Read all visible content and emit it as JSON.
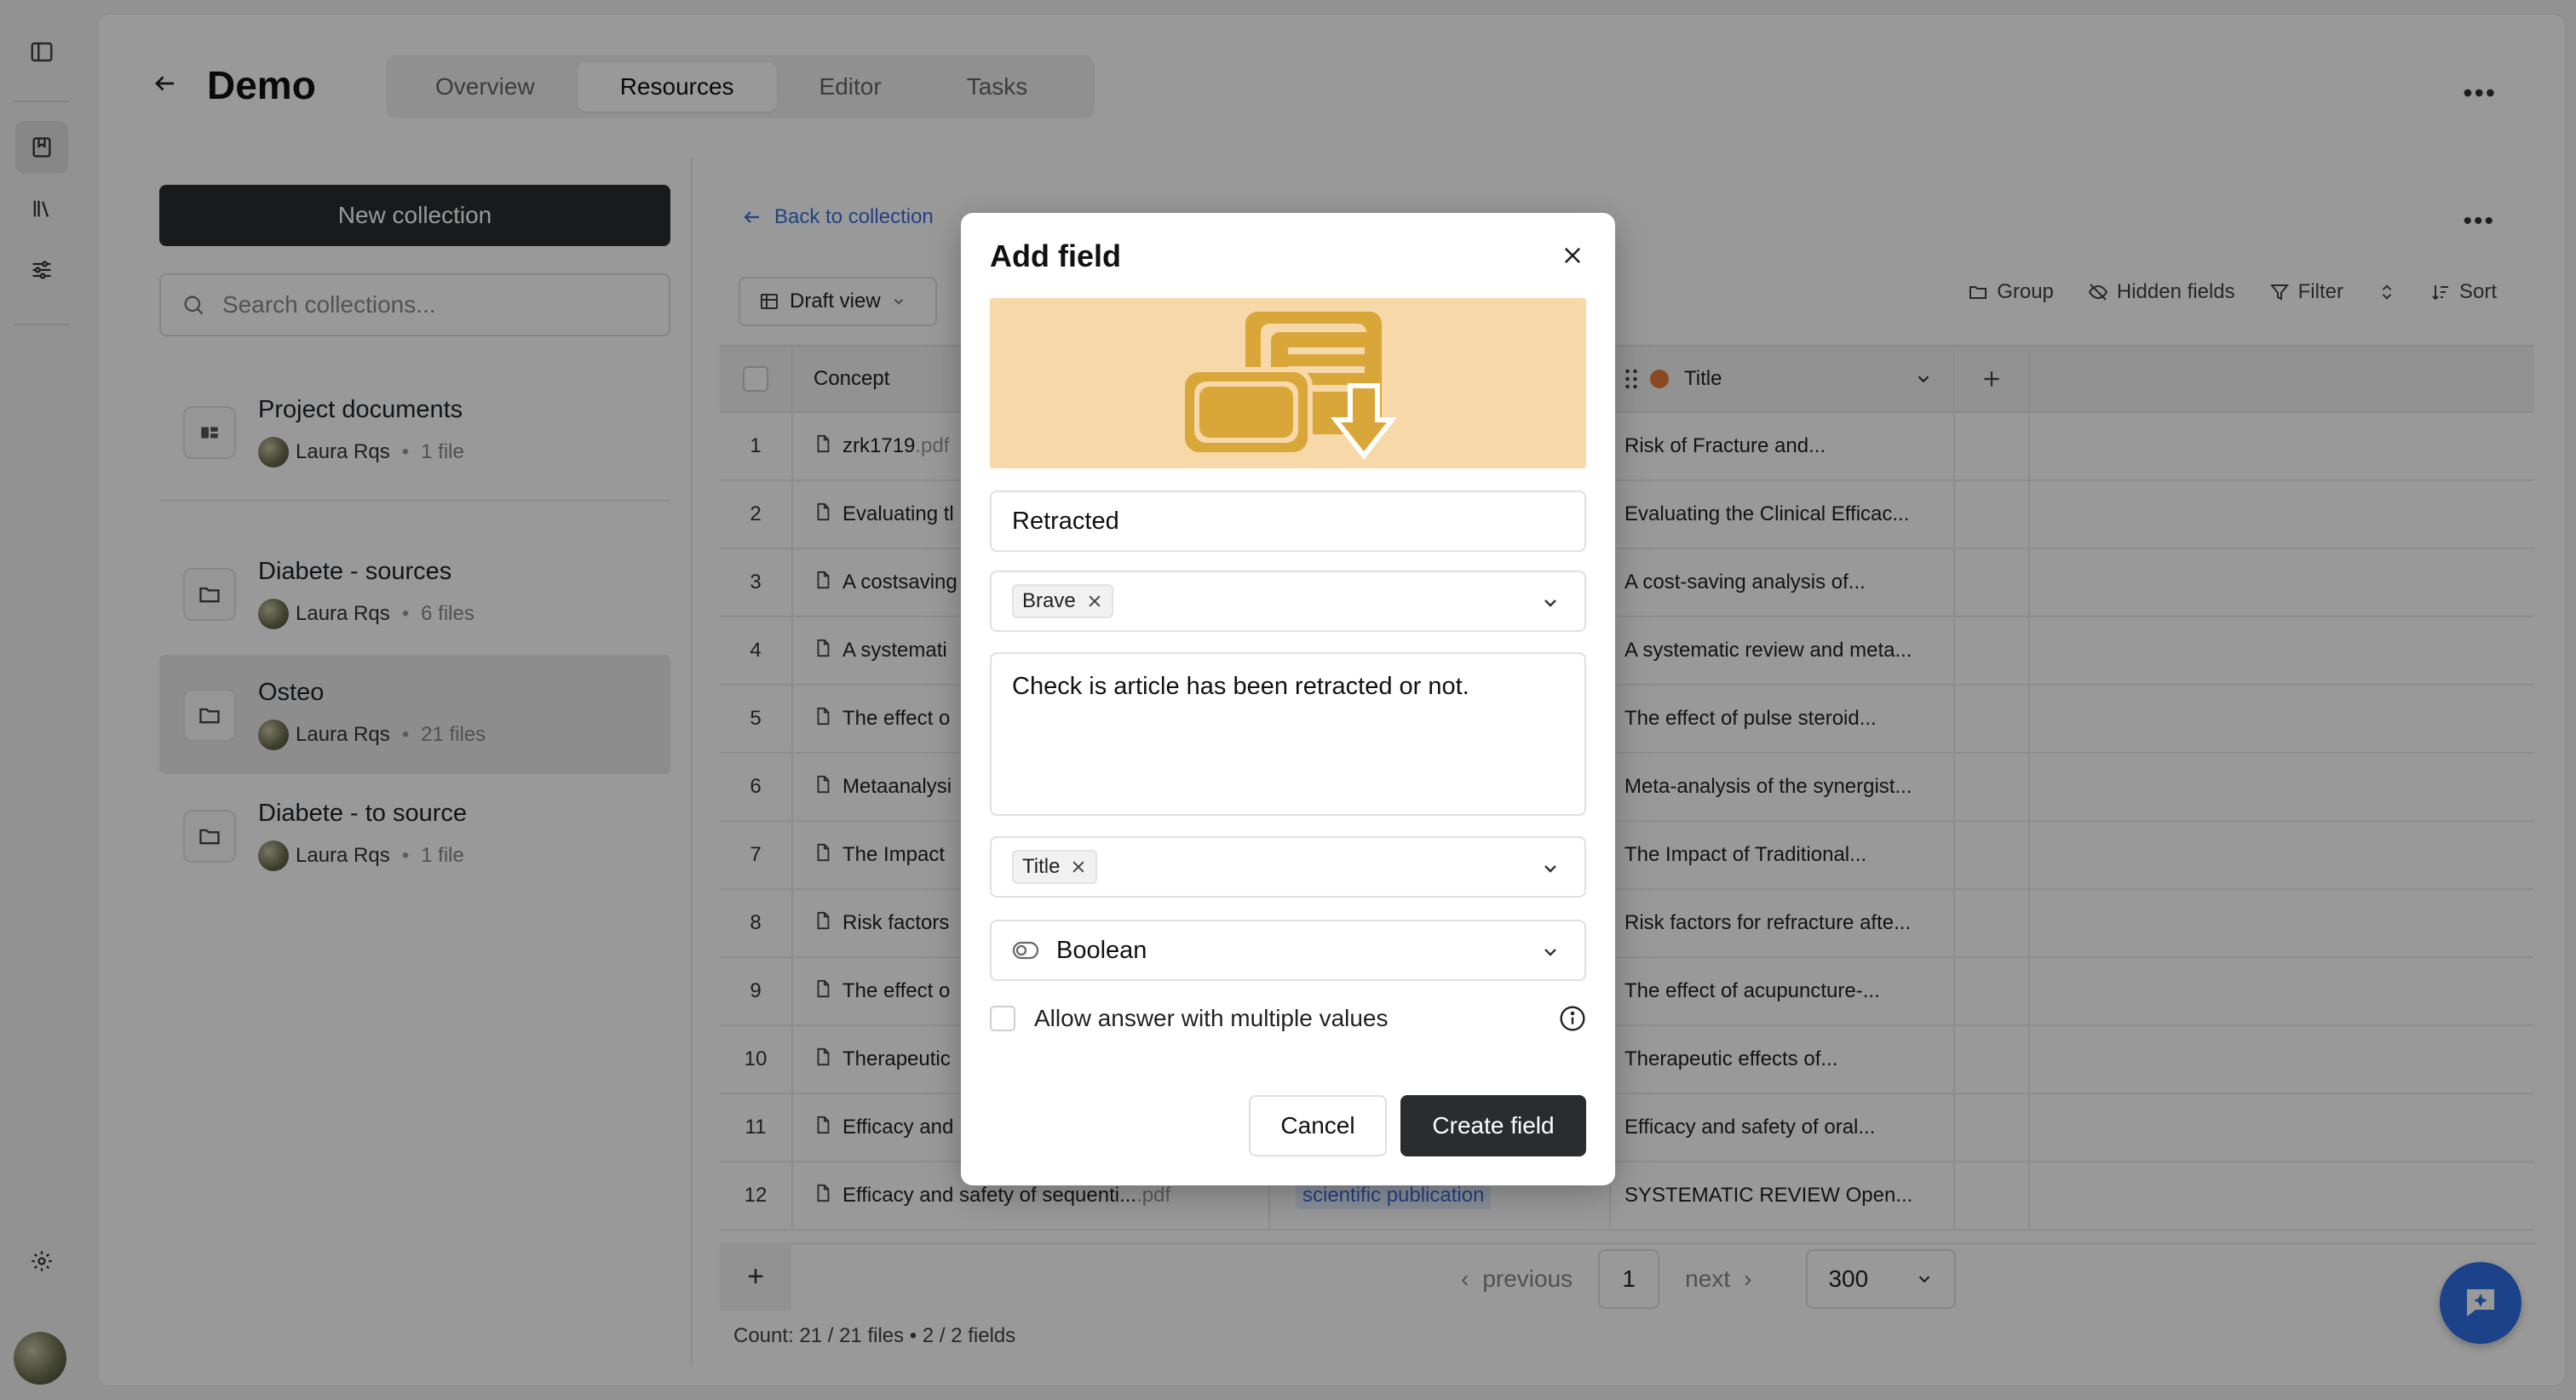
{
  "header": {
    "title": "Demo",
    "tabs": [
      {
        "label": "Overview"
      },
      {
        "label": "Resources"
      },
      {
        "label": "Editor"
      },
      {
        "label": "Tasks"
      }
    ],
    "active_tab": "Resources"
  },
  "collections": {
    "new_button": "New collection",
    "search_placeholder": "Search collections...",
    "items": [
      {
        "name": "Project documents",
        "owner": "Laura Rqs",
        "count": "1 file"
      },
      {
        "name": "Diabete - sources",
        "owner": "Laura Rqs",
        "count": "6 files"
      },
      {
        "name": "Osteo",
        "owner": "Laura Rqs",
        "count": "21 files"
      },
      {
        "name": "Diabete - to source",
        "owner": "Laura Rqs",
        "count": "1 file"
      }
    ],
    "active": "Osteo"
  },
  "table_view": {
    "back_label": "Back to collection",
    "view_label": "Draft view",
    "toolbar": {
      "group": "Group",
      "hidden_fields": "Hidden fields",
      "filter": "Filter",
      "sort": "Sort"
    },
    "columns": {
      "concept": "Concept",
      "title": "Title"
    },
    "rows": [
      {
        "n": "1",
        "concept": "zrk1719",
        "ext": ".pdf",
        "title": "Risk of Fracture and..."
      },
      {
        "n": "2",
        "concept": "Evaluating tl",
        "ext": "",
        "title": "Evaluating the Clinical Efficac..."
      },
      {
        "n": "3",
        "concept": "A costsaving",
        "ext": "",
        "title": "A cost-saving analysis of..."
      },
      {
        "n": "4",
        "concept": "A systemati",
        "ext": "",
        "title": "A systematic review and meta..."
      },
      {
        "n": "5",
        "concept": "The effect o",
        "ext": "",
        "title": "The effect of pulse steroid..."
      },
      {
        "n": "6",
        "concept": "Metaanalysi",
        "ext": "",
        "title": "Meta-analysis of the synergist..."
      },
      {
        "n": "7",
        "concept": "The Impact",
        "ext": "",
        "title": "The Impact of Traditional..."
      },
      {
        "n": "8",
        "concept": "Risk factors",
        "ext": "",
        "title": "Risk factors for refracture afte..."
      },
      {
        "n": "9",
        "concept": "The effect o",
        "ext": "",
        "title": "The effect of acupuncture-..."
      },
      {
        "n": "10",
        "concept": "Therapeutic",
        "ext": "",
        "title": "Therapeutic effects of..."
      },
      {
        "n": "11",
        "concept": "Efficacy and",
        "ext": "",
        "title": "Efficacy and safety of oral..."
      },
      {
        "n": "12",
        "concept": "Efficacy and safety of sequenti...",
        "ext": ".pdf",
        "type": "scientific publication",
        "title": "SYSTEMATIC REVIEW Open..."
      }
    ],
    "pagination": {
      "previous": "previous",
      "page": "1",
      "next": "next",
      "per_page": "300"
    },
    "count_text": "Count: 21 / 21 files • 2 / 2 fields"
  },
  "modal": {
    "title": "Add field",
    "name_value": "Retracted",
    "source_chip": "Brave",
    "description": "Check is article has been retracted or not.",
    "input_chip": "Title",
    "type_value": "Boolean",
    "multiple_values_label": "Allow answer with multiple values",
    "cancel": "Cancel",
    "create": "Create field",
    "banner_color": "#f6d8a9",
    "illustration_color": "#d9a63a"
  },
  "colors": {
    "accent": "#2f6fe4",
    "link": "#3b6fd8",
    "dark_button": "#2b2c2e"
  }
}
